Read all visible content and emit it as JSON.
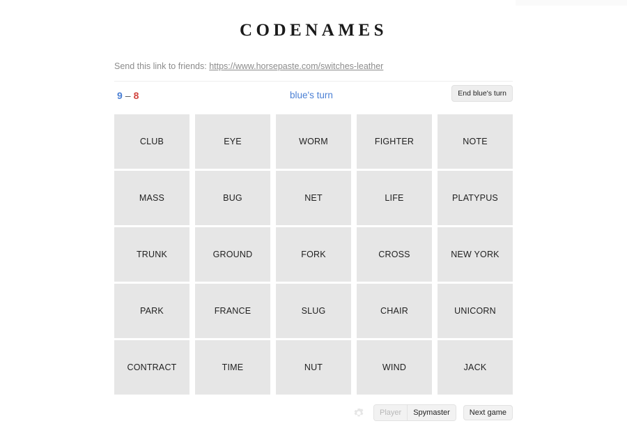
{
  "header": {
    "title": "CODENAMES"
  },
  "share": {
    "prefix": "Send this link to friends:",
    "link_text": "https://www.horsepaste.com/switches-leather"
  },
  "status": {
    "score_blue": "9",
    "score_separator": "–",
    "score_red": "8",
    "turn_text": "blue's turn",
    "end_turn_label": "End blue's turn",
    "blue_color": "#4a7fd4",
    "red_color": "#d2453f"
  },
  "board": {
    "rows": 5,
    "cols": 5,
    "card_color": "#e6e6e6",
    "cards": [
      {
        "word": "CLUB"
      },
      {
        "word": "EYE"
      },
      {
        "word": "WORM"
      },
      {
        "word": "FIGHTER"
      },
      {
        "word": "NOTE"
      },
      {
        "word": "MASS"
      },
      {
        "word": "BUG"
      },
      {
        "word": "NET"
      },
      {
        "word": "LIFE"
      },
      {
        "word": "PLATYPUS"
      },
      {
        "word": "TRUNK"
      },
      {
        "word": "GROUND"
      },
      {
        "word": "FORK"
      },
      {
        "word": "CROSS"
      },
      {
        "word": "NEW YORK"
      },
      {
        "word": "PARK"
      },
      {
        "word": "FRANCE"
      },
      {
        "word": "SLUG"
      },
      {
        "word": "CHAIR"
      },
      {
        "word": "UNICORN"
      },
      {
        "word": "CONTRACT"
      },
      {
        "word": "TIME"
      },
      {
        "word": "NUT"
      },
      {
        "word": "WIND"
      },
      {
        "word": "JACK"
      }
    ]
  },
  "toolbar": {
    "settings_icon": "gear-icon",
    "player_label": "Player",
    "spymaster_label": "Spymaster",
    "next_game_label": "Next game"
  }
}
